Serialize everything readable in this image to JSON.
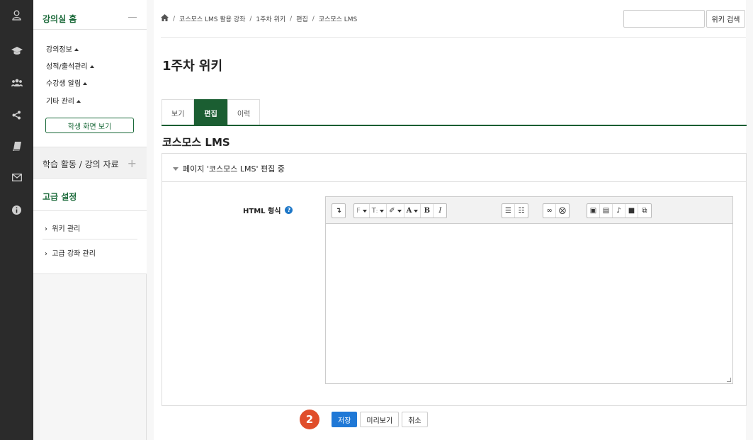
{
  "rail": {
    "icons": [
      "user-icon",
      "graduation-cap-icon",
      "users-icon",
      "share-icon",
      "book-icon",
      "mail-icon",
      "info-icon"
    ]
  },
  "sidebar": {
    "home_label": "강의실 홈",
    "menu_items": [
      "강의정보",
      "성적/출석관리",
      "수강생 알림",
      "기타 관리"
    ],
    "student_view_button": "학생 화면 보기",
    "activity_label": "학습 활동 / 강의 자료",
    "advanced_label": "고급 설정",
    "advanced_items": [
      "위키 관리",
      "고급 강좌 관리"
    ]
  },
  "breadcrumb": {
    "items": [
      "코스모스 LMS 활용 강좌",
      "1주차 위키",
      "편집",
      "코스모스 LMS"
    ]
  },
  "search": {
    "button_label": "위키 검색"
  },
  "page": {
    "title": "1주차 위키",
    "tabs": [
      "보기",
      "편집",
      "이력"
    ],
    "active_tab": "편집",
    "section_title": "코스모스 LMS",
    "panel_heading": "페이지 '코스모스 LMS' 편집 중",
    "field_label": "HTML 형식"
  },
  "actions": {
    "step_number": "2",
    "save": "저장",
    "preview": "미리보기",
    "cancel": "취소"
  },
  "colors": {
    "accent_green": "#1b5e32",
    "primary_blue": "#1f78d6",
    "step_badge": "#e04e2b"
  }
}
